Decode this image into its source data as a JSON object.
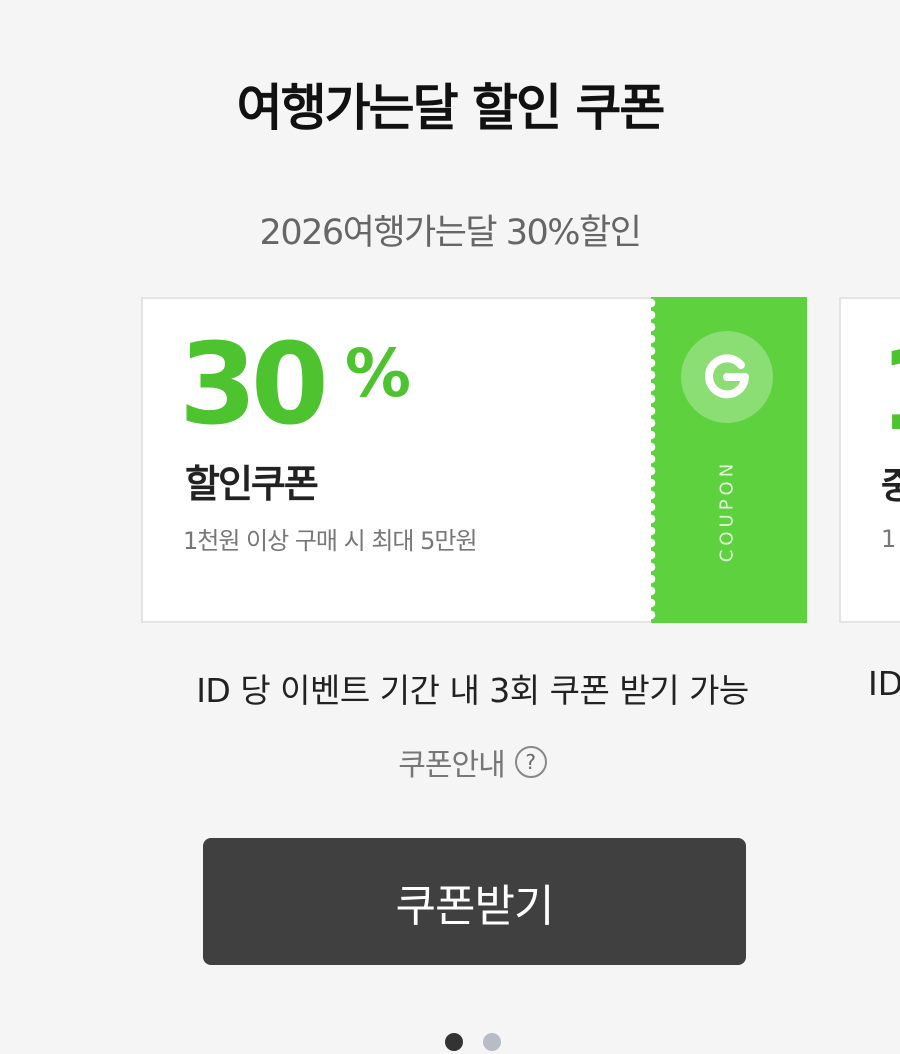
{
  "page": {
    "title": "여행가는달 할인 쿠폰",
    "subtitle": "2026여행가는달 30%할인"
  },
  "coupons": [
    {
      "discount_value": "30",
      "discount_unit": "%",
      "type": "할인쿠폰",
      "condition": "1천원 이상 구매 시 최대 5만원",
      "stub_label": "COUPON",
      "limit": "ID 당 이벤트 기간 내 3회 쿠폰 받기 가능"
    },
    {
      "discount_value": "1",
      "type": "중",
      "condition": "1",
      "limit": "ID"
    }
  ],
  "guide": {
    "label": "쿠폰안내",
    "help": "?"
  },
  "button": {
    "label": "쿠폰받기"
  },
  "pagination": {
    "total": 2,
    "current": 1
  },
  "colors": {
    "brand_green": "#5ed13f",
    "discount_green": "#4ec330",
    "button_dark": "#404040"
  },
  "icons": {
    "stub_logo": "g-logo-icon",
    "help": "question-circle-icon"
  }
}
